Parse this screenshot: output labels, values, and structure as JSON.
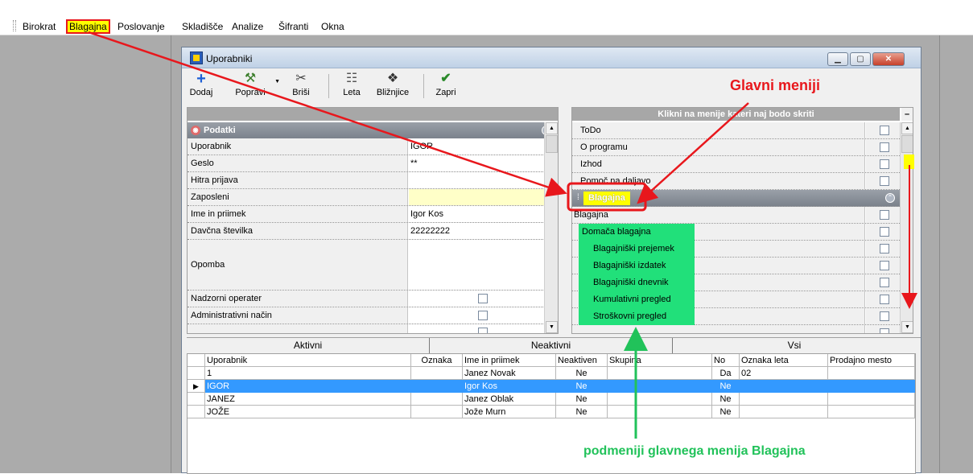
{
  "menubar": {
    "items": [
      "Birokrat",
      "Blagajna",
      "Poslovanje",
      "Skladišče",
      "Analize",
      "Šifranti",
      "Okna"
    ],
    "highlighted_index": 1
  },
  "window": {
    "title": "Uporabniki",
    "caption_buttons": [
      "minimize",
      "maximize",
      "close"
    ]
  },
  "toolbar": {
    "buttons": [
      {
        "label": "Dodaj",
        "icon": "plus-icon"
      },
      {
        "label": "Popravi",
        "icon": "hammer-icon"
      },
      {
        "label": "Briši",
        "icon": "scissors-icon"
      },
      {
        "label": "Leta",
        "icon": "calendar-icon"
      },
      {
        "label": "Bližnjice",
        "icon": "shortcuts-icon"
      },
      {
        "label": "Zapri",
        "icon": "checkmark-icon"
      }
    ]
  },
  "properties": {
    "category": "Podatki",
    "rows": [
      {
        "label": "Uporabnik",
        "value": "IGOR"
      },
      {
        "label": "Geslo",
        "value": "**"
      },
      {
        "label": "Hitra prijava",
        "value": ""
      },
      {
        "label": "Zaposleni",
        "value": ""
      },
      {
        "label": "Ime in priimek",
        "value": "Igor Kos"
      },
      {
        "label": "Davčna številka",
        "value": "22222222"
      },
      {
        "label": "Opomba",
        "value": ""
      },
      {
        "label": "Nadzorni operater",
        "value": ""
      },
      {
        "label": "Administrativni način",
        "value": ""
      }
    ]
  },
  "menus_panel": {
    "header": "Klikni na menije kateri naj bodo skriti",
    "collapse_label": "–",
    "rows_before": [
      "ToDo",
      "O programu",
      "Izhod",
      "Pomoč na daljavo"
    ],
    "category": "Blagajna",
    "rows_after": [
      "Blagajna",
      "Domača blagajna",
      "Blagajniški prejemek",
      "Blagajniški izdatek",
      "Blagajniški dnevnik",
      "Kumulativni pregled",
      "Stroškovni pregled"
    ]
  },
  "tabs": [
    "Aktivni",
    "Neaktivni",
    "Vsi"
  ],
  "users_table": {
    "columns": [
      "Uporabnik",
      "Oznaka",
      "Ime in priimek",
      "Neaktiven",
      "Skupina",
      "No",
      "Oznaka leta",
      "Prodajno mesto"
    ],
    "rows": [
      [
        "1",
        "",
        "Janez Novak",
        "Ne",
        "",
        "Da",
        "02",
        ""
      ],
      [
        "IGOR",
        "",
        "Igor Kos",
        "Ne",
        "",
        "Ne",
        "",
        ""
      ],
      [
        "JANEZ",
        "",
        "Janez Oblak",
        "Ne",
        "",
        "Ne",
        "",
        ""
      ],
      [
        "JOŽE",
        "",
        "Jože Murn",
        "Ne",
        "",
        "Ne",
        "",
        ""
      ]
    ],
    "selected_row": 1
  },
  "annotations": {
    "main_menus": "Glavni meniji",
    "submenus": "podmeniji glavnega menija Blagajna"
  },
  "colors": {
    "annotation_red": "#e8171c",
    "annotation_green": "#21c25a",
    "highlight_yellow": "#ffff00",
    "submenu_green": "#21e07a",
    "selection_blue": "#3399ff"
  }
}
